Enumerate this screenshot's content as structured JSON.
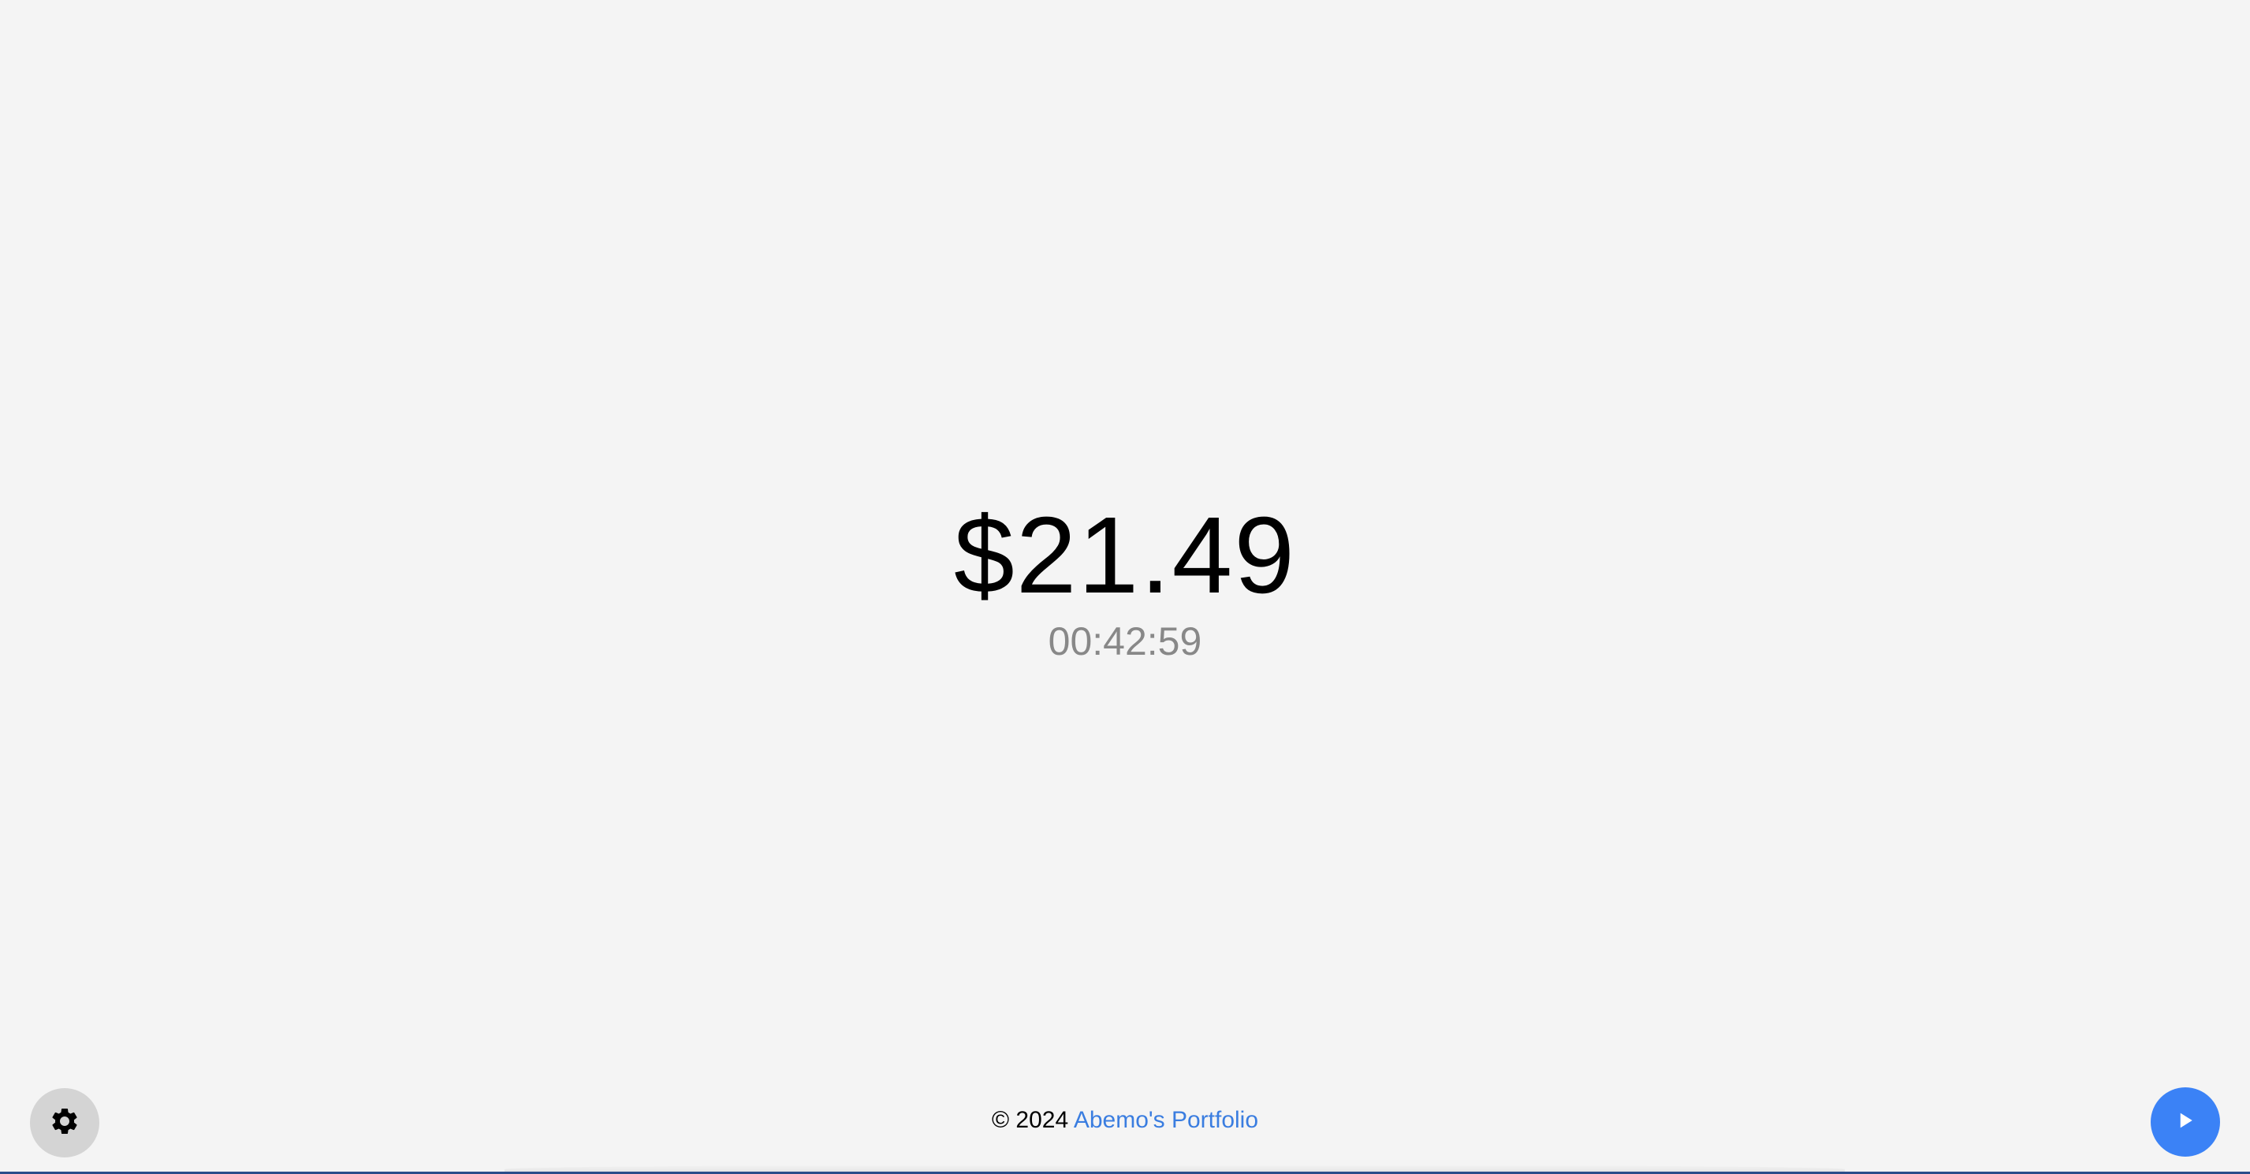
{
  "timer": {
    "amount": "$21.49",
    "elapsed": "00:42:59"
  },
  "footer": {
    "copyright": "© 2024",
    "link_label": "Abemo's Portfolio"
  },
  "buttons": {
    "settings_icon": "gear-icon",
    "play_icon": "play-icon"
  },
  "colors": {
    "background": "#f4f4f4",
    "accent": "#3b82f6",
    "link": "#3a7de0",
    "muted_text": "#888888",
    "settings_button": "#d4d4d4"
  }
}
